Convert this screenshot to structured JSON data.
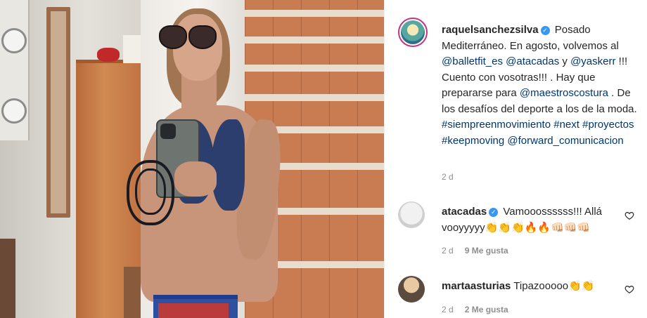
{
  "post": {
    "username": "raquelsanchezsilva",
    "caption_segments": [
      {
        "type": "text",
        "value": "Posado Mediterráneo. En agosto, volvemos al "
      },
      {
        "type": "mention",
        "value": "@balletfit_es"
      },
      {
        "type": "text",
        "value": " "
      },
      {
        "type": "mention",
        "value": "@atacadas"
      },
      {
        "type": "text",
        "value": " y "
      },
      {
        "type": "mention",
        "value": "@yaskerr"
      },
      {
        "type": "text",
        "value": " !!! Cuento con vosotras!!! . Hay que prepararse para "
      },
      {
        "type": "mention",
        "value": "@maestroscostura"
      },
      {
        "type": "text",
        "value": " . De los desafíos del deporte a los de la moda. "
      },
      {
        "type": "tag",
        "value": "#siempreenmovimiento"
      },
      {
        "type": "text",
        "value": " "
      },
      {
        "type": "tag",
        "value": "#next"
      },
      {
        "type": "text",
        "value": " "
      },
      {
        "type": "tag",
        "value": "#proyectos"
      },
      {
        "type": "text",
        "value": " "
      },
      {
        "type": "tag",
        "value": "#keepmoving"
      },
      {
        "type": "text",
        "value": " "
      },
      {
        "type": "mention",
        "value": "@forward_comunicacion"
      }
    ],
    "time": "2 d"
  },
  "comments": [
    {
      "username": "atacadas",
      "verified": true,
      "text": "Vamooossssss!!! Allá vooyyyyy👏👏👏🔥🔥👊🏻👊🏻👊🏻",
      "time": "2 d",
      "likes": "9 Me gusta"
    },
    {
      "username": "martaasturias",
      "verified": false,
      "text": "Tipazooooo👏👏",
      "time": "2 d",
      "likes": "2 Me gusta"
    }
  ],
  "colors": {
    "link": "#00376b",
    "verified": "#3897f0",
    "muted": "#8e8e8e",
    "text": "#262626"
  },
  "icons": [
    "verified-badge-icon",
    "heart-icon"
  ]
}
